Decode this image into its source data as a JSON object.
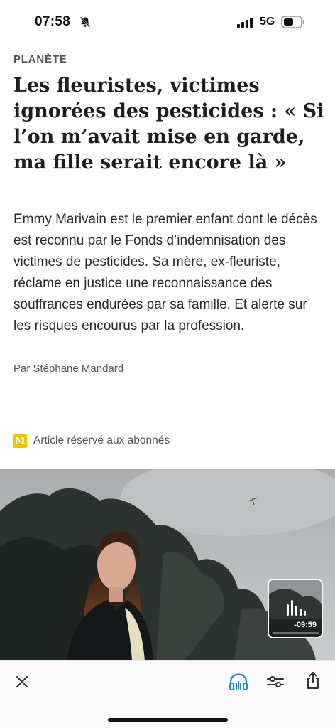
{
  "status": {
    "time": "07:58",
    "network": "5G"
  },
  "article": {
    "rubric": "PLANÈTE",
    "headline": "Les fleuristes, victimes ignorées des pesticides : « Si l’on m’avait mise en garde, ma fille serait encore là »",
    "lede": "Emmy Marivain est le premier enfant dont le décès est reconnu par le Fonds d’indemnisation des victimes de pesticides. Sa mère, ex-fleuriste, réclame en justice une reconnaissance des souffrances endurées par sa famille. Et alerte sur les risques encourus par la profession.",
    "byline": "Par Stéphane Mandard",
    "subscriber_badge": "M",
    "subscriber_label": "Article réservé aux abonnés"
  },
  "audio_player": {
    "remaining": "-09:59",
    "progress": 0.06
  },
  "toolbar": {
    "items": [
      "close-icon",
      "headphones-icon",
      "settings-sliders-icon",
      "share-icon"
    ],
    "accent_color": "#1d8be0"
  }
}
